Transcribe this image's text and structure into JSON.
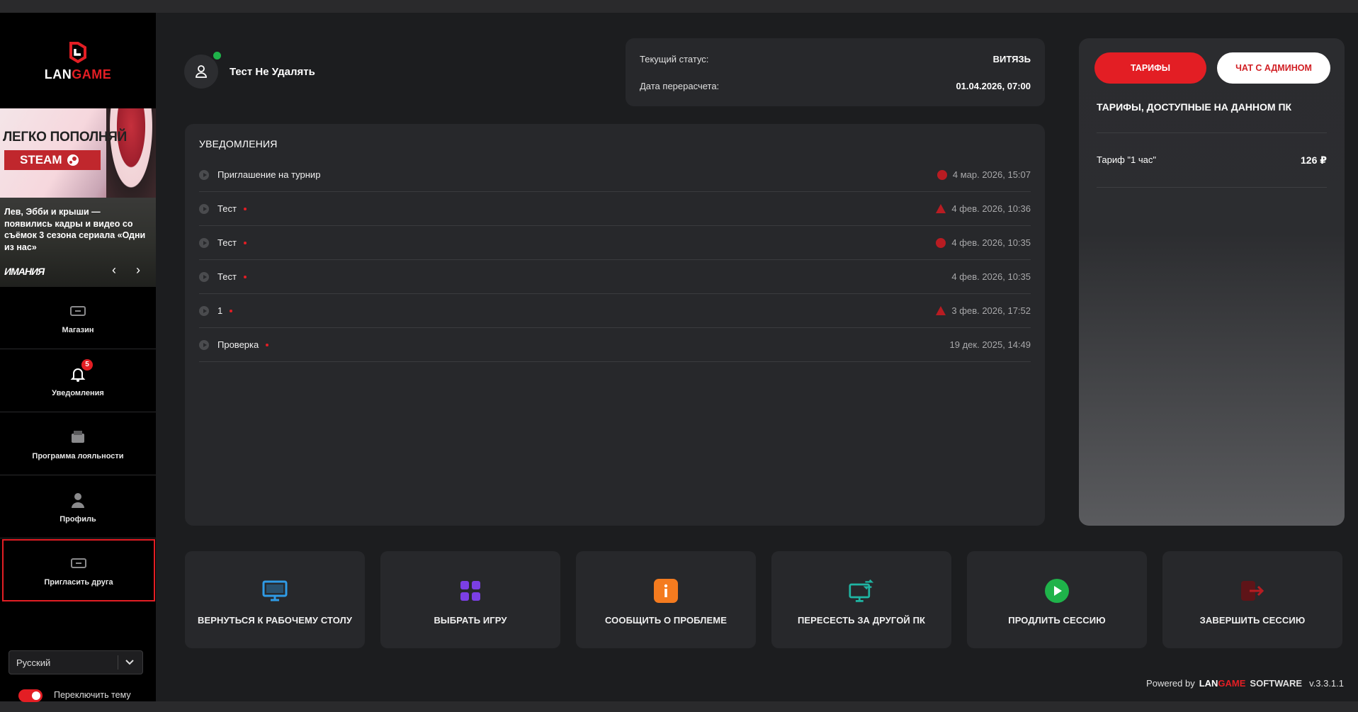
{
  "brand": {
    "logo_text_white": "LAN",
    "logo_text_red": "GAME"
  },
  "promo": {
    "headline": "ЛЕГКО ПОПОЛНЯЙ",
    "steam_label": "STEAM"
  },
  "news": {
    "text": "Лев, Эбби и крыши — появились кадры и видео со съёмок 3 сезона сериала «Одни из нас»",
    "source": "ИМАНИЯ",
    "prev": "‹",
    "next": "›"
  },
  "sidebar": {
    "items": [
      {
        "label": "Магазин",
        "icon": "shop-icon"
      },
      {
        "label": "Уведомления",
        "icon": "bell-icon",
        "badge": "5"
      },
      {
        "label": "Программа лояльности",
        "icon": "wallet-icon"
      },
      {
        "label": "Профиль",
        "icon": "user-icon"
      },
      {
        "label": "Пригласить друга",
        "icon": "invite-icon",
        "active": true
      }
    ],
    "language": "Русский",
    "theme_toggle_label": "Переключить тему"
  },
  "user": {
    "name": "Тест Не Удалять",
    "online": true
  },
  "status": {
    "current_status_label": "Текущий статус:",
    "current_status_value": "ВИТЯЗЬ",
    "recalc_label": "Дата перерасчета:",
    "recalc_value": "01.04.2026, 07:00"
  },
  "notifications": {
    "title": "УВЕДОМЛЕНИЯ",
    "items": [
      {
        "text": "Приглашение на турнир",
        "unread": false,
        "priority": "circle",
        "date": "4 мар. 2026, 15:07"
      },
      {
        "text": "Тест",
        "unread": true,
        "priority": "triangle",
        "date": "4 фев. 2026, 10:36"
      },
      {
        "text": "Тест",
        "unread": true,
        "priority": "circle",
        "date": "4 фев. 2026, 10:35"
      },
      {
        "text": "Тест",
        "unread": true,
        "priority": "none",
        "date": "4 фев. 2026, 10:35"
      },
      {
        "text": "1",
        "unread": true,
        "priority": "triangle",
        "date": "3 фев. 2026, 17:52"
      },
      {
        "text": "Проверка",
        "unread": true,
        "priority": "none",
        "date": "19 дек. 2025, 14:49"
      }
    ]
  },
  "tariffs": {
    "tab_tariffs": "ТАРИФЫ",
    "tab_chat": "ЧАТ С АДМИНОМ",
    "heading": "ТАРИФЫ, ДОСТУПНЫЕ НА ДАННОМ ПК",
    "items": [
      {
        "name": "Тариф \"1 час\"",
        "price": "126 ₽"
      }
    ]
  },
  "actions": [
    {
      "label": "ВЕРНУТЬСЯ К РАБОЧЕМУ СТОЛУ",
      "icon": "monitor-icon",
      "color": "#2f9be6"
    },
    {
      "label": "ВЫБРАТЬ ИГРУ",
      "icon": "grid-icon",
      "color": "#7b3fe4"
    },
    {
      "label": "СООБЩИТЬ О ПРОБЛЕМЕ",
      "icon": "info-icon",
      "color": "#f47b1f"
    },
    {
      "label": "ПЕРЕСЕСТЬ ЗА ДРУГОЙ ПК",
      "icon": "switch-pc-icon",
      "color": "#1fb5a3"
    },
    {
      "label": "ПРОДЛИТЬ СЕССИЮ",
      "icon": "play-icon",
      "color": "#1fb34a"
    },
    {
      "label": "ЗАВЕРШИТЬ СЕССИЮ",
      "icon": "logout-icon",
      "color": "#b81c22"
    }
  ],
  "footer": {
    "powered_by": "Powered by",
    "brand_white": "LAN",
    "brand_red": "GAME",
    "software": "SOFTWARE",
    "version": "v.3.3.1.1"
  }
}
